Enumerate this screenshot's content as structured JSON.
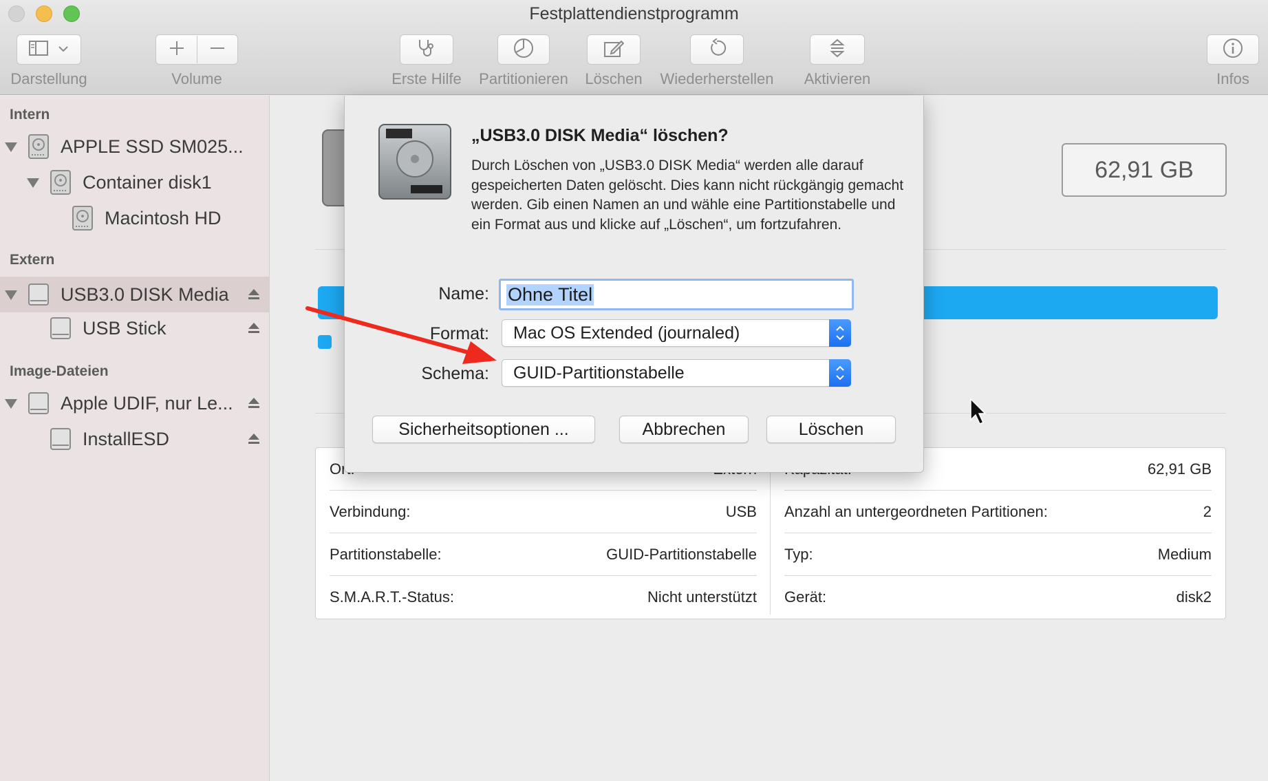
{
  "window": {
    "title": "Festplattendienstprogramm"
  },
  "toolbar": {
    "darstellung_label": "Darstellung",
    "volume_label": "Volume",
    "erste_hilfe_label": "Erste Hilfe",
    "partitionieren_label": "Partitionieren",
    "loeschen_label": "Löschen",
    "wiederherstellen_label": "Wiederherstellen",
    "aktivieren_label": "Aktivieren",
    "infos_label": "Infos"
  },
  "sidebar": {
    "sections": [
      {
        "header": "Intern"
      },
      {
        "header": "Extern"
      },
      {
        "header": "Image-Dateien"
      }
    ],
    "items": [
      {
        "label": "APPLE SSD SM025..."
      },
      {
        "label": "Container disk1"
      },
      {
        "label": "Macintosh HD"
      },
      {
        "label": "USB3.0 DISK Media"
      },
      {
        "label": "USB Stick"
      },
      {
        "label": "Apple UDIF, nur Le..."
      },
      {
        "label": "InstallESD"
      }
    ],
    "selected": "USB3.0 DISK Media"
  },
  "main": {
    "capacity": "62,91 GB",
    "info": {
      "left": [
        {
          "label": "Ort:",
          "value": "Extern"
        },
        {
          "label": "Verbindung:",
          "value": "USB"
        },
        {
          "label": "Partitionstabelle:",
          "value": "GUID-Partitionstabelle"
        },
        {
          "label": "S.M.A.R.T.-Status:",
          "value": "Nicht unterstützt"
        }
      ],
      "right": [
        {
          "label": "Kapazität:",
          "value": "62,91 GB"
        },
        {
          "label": "Anzahl an untergeordneten Partitionen:",
          "value": "2"
        },
        {
          "label": "Typ:",
          "value": "Medium"
        },
        {
          "label": "Gerät:",
          "value": "disk2"
        }
      ]
    }
  },
  "dialog": {
    "title": "„USB3.0 DISK Media“ löschen?",
    "message": "Durch Löschen von „USB3.0 DISK Media“ werden alle darauf gespeicherten Daten gelöscht. Dies kann nicht rückgängig gemacht werden. Gib einen Namen an und wähle eine Partitionstabelle und ein Format aus und klicke auf „Löschen“, um fortzufahren.",
    "name_label": "Name:",
    "name_value": "Ohne Titel",
    "format_label": "Format:",
    "format_value": "Mac OS Extended (journaled)",
    "schema_label": "Schema:",
    "schema_value": "GUID-Partitionstabelle",
    "security_button": "Sicherheitsoptionen ...",
    "cancel_button": "Abbrechen",
    "erase_button": "Löschen"
  },
  "colors": {
    "accent": "#1da8f2",
    "annotation_arrow": "#ee2a1f",
    "selection": "#b3d3ff"
  }
}
